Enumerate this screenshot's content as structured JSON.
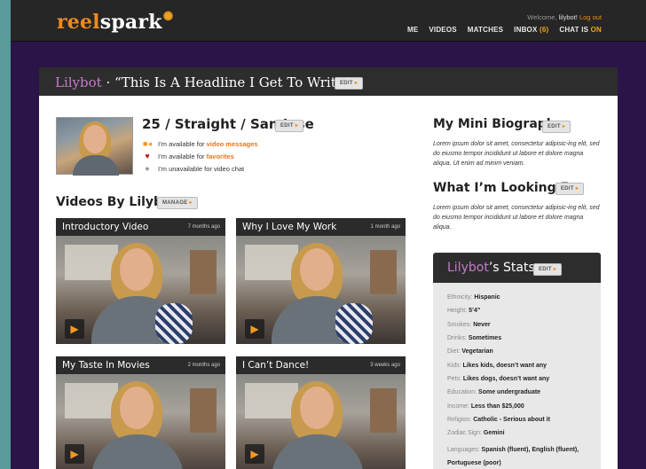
{
  "header": {
    "logo_reel": "reel",
    "logo_spark": "spark",
    "welcome_prefix": "Welcome,",
    "welcome_user": "lilybot!",
    "logout": "Log out",
    "nav": {
      "me": "ME",
      "videos": "VIDEOS",
      "matches": "MATCHES",
      "inbox": "INBOX",
      "inbox_count": "(6)",
      "chat_prefix": "CHAT IS",
      "chat_status": "ON"
    }
  },
  "headline": {
    "user": "Lilybot",
    "separator": " · ",
    "text": "“This Is A Headline I Get To Write”",
    "edit": "EDIT"
  },
  "profile": {
    "summary": "25 / Straight / San Jose",
    "edit": "EDIT",
    "availability": [
      {
        "prefix": "I’m available for",
        "highlight": "video messages"
      },
      {
        "prefix": "I’m available for",
        "highlight": "favorites"
      },
      {
        "prefix": "I’m unavailable for video chat",
        "highlight": ""
      }
    ]
  },
  "videos": {
    "title": "Videos By Lilybot",
    "manage": "MANAGE",
    "items": [
      {
        "title": "Introductory Video",
        "ago": "7 months ago"
      },
      {
        "title": "Why I Love My Work",
        "ago": "1 month ago"
      },
      {
        "title": "My Taste In Movies",
        "ago": "2 months ago"
      },
      {
        "title": "I Can’t Dance!",
        "ago": "3 weeks ago"
      }
    ]
  },
  "bio": {
    "title": "My Mini Biography",
    "edit": "EDIT",
    "text": "Lorem ipsum dolor sit amet, consectetur adipisic-ing elit, sed do eiusmo tempor incididunt ut labore et dolore magna aliqua. Ut enim ad minim veniam."
  },
  "looking": {
    "title": "What I’m Looking For",
    "edit": "EDIT",
    "text": "Lorem ipsum dolor sit amet, consectetur adipisic-ing elit, sed do eiusmo tempor incididunt ut labore et dolore magna aliqua."
  },
  "stats": {
    "user": "Lilybot",
    "suffix": "’s Stats",
    "edit": "EDIT",
    "rows": [
      {
        "label": "Ethnicity:",
        "value": "Hispanic"
      },
      {
        "label": "Height:",
        "value": "5’4”"
      },
      {
        "label": "Smokes:",
        "value": "Never"
      },
      {
        "label": "Drinks:",
        "value": "Sometimes"
      },
      {
        "label": "Diet:",
        "value": "Vegetarian"
      },
      {
        "label": "Kids:",
        "value": "Likes kids, doesn’t want any"
      },
      {
        "label": "Pets:",
        "value": "Likes dogs, doesn’t want any"
      },
      {
        "label": "Education:",
        "value": "Some undergraduate"
      },
      {
        "label": "Income:",
        "value": "Less than $25,000"
      },
      {
        "label": "Religion:",
        "value": "Catholic - Serious about it"
      },
      {
        "label": "Zodiac Sign:",
        "value": "Gemini"
      },
      {
        "label": "Languages:",
        "value": "Spanish (fluent), English (fluent), Portuguese (poor)"
      }
    ]
  }
}
